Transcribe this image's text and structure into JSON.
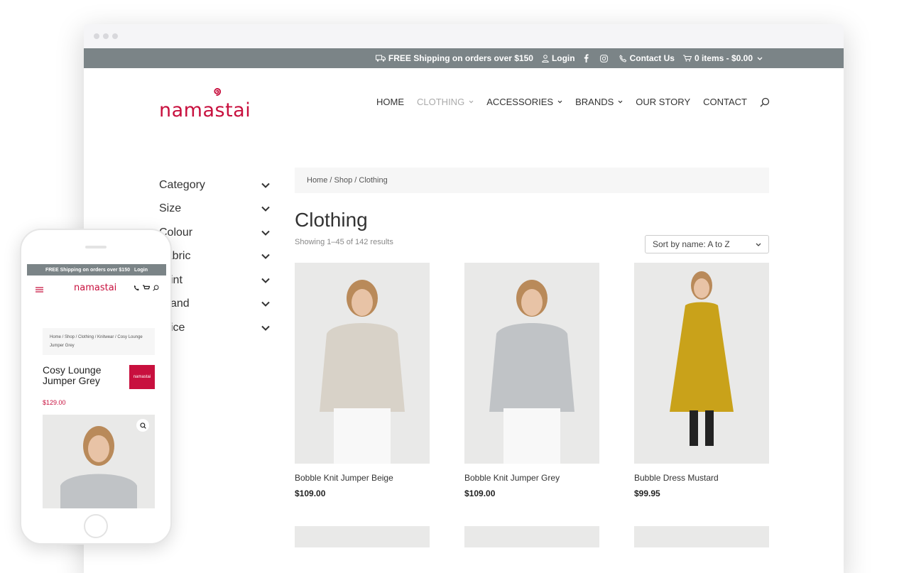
{
  "topbar": {
    "shipping": "FREE Shipping on orders over $150",
    "login": "Login",
    "contact": "Contact Us",
    "cart": "0 items - $0.00"
  },
  "brand": {
    "logo_text": "namastai",
    "accent": "#c8103e"
  },
  "nav": [
    {
      "label": "HOME"
    },
    {
      "label": "CLOTHING"
    },
    {
      "label": "ACCESSORIES"
    },
    {
      "label": "BRANDS"
    },
    {
      "label": "OUR STORY"
    },
    {
      "label": "CONTACT"
    }
  ],
  "filters": [
    "Category",
    "Size",
    "Colour",
    "Fabric",
    "Print",
    "Brand",
    "Price"
  ],
  "breadcrumb": "Home / Shop / Clothing",
  "page": {
    "title": "Clothing",
    "results": "Showing 1–45 of 142 results",
    "sort": "Sort by name: A to Z"
  },
  "products": [
    {
      "name": "Bobble Knit Jumper Beige",
      "price": "$109.00",
      "color": "#d8d2c8"
    },
    {
      "name": "Bobble Knit Jumper Grey",
      "price": "$109.00",
      "color": "#c0c3c6"
    },
    {
      "name": "Bubble Dress Mustard",
      "price": "$99.95",
      "color": "#c9a21a"
    }
  ],
  "mobile": {
    "shipping": "FREE Shipping on orders over $150",
    "login": "Login",
    "logo_text": "namastai",
    "breadcrumb": "Home / Shop / Clothing / Knitwear / Cosy Lounge Jumper Grey",
    "product_title": "Cosy Lounge Jumper Grey",
    "price": "$129.00",
    "badge": "namastai"
  }
}
